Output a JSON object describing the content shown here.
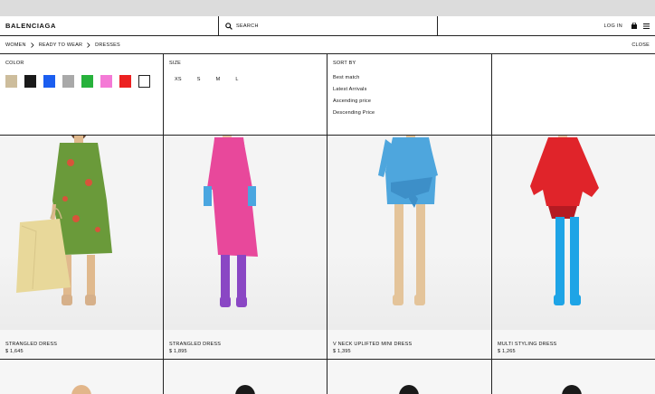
{
  "header": {
    "logo": "BALENCIAGA",
    "search_label": "SEARCH",
    "login_label": "LOG IN"
  },
  "breadcrumb": {
    "items": [
      "WOMEN",
      "READY TO WEAR",
      "DRESSES"
    ],
    "close_label": "CLOSE"
  },
  "filters": {
    "color": {
      "title": "COLOR",
      "swatches": [
        "#cdbd9c",
        "#1a1a1a",
        "#1b5ef0",
        "#a9a9a9",
        "#27b23b",
        "#f47ad6",
        "#ec2121",
        "#ffffff"
      ]
    },
    "size": {
      "title": "SIZE",
      "options": [
        "XS",
        "S",
        "M",
        "L"
      ]
    },
    "sort": {
      "title": "SORT BY",
      "options": [
        "Best match",
        "Latest Arrivals",
        "Ascending price",
        "Descending Price"
      ]
    }
  },
  "products": [
    {
      "name": "STRANGLED DRESS",
      "price": "$ 1,645",
      "colors": {
        "dress": "#6a9a3a",
        "accent": "#d8543a",
        "legs": "#e0b98d",
        "shoes": "#d6b08a",
        "bag": "#e8d89a"
      }
    },
    {
      "name": "STRANGLED DRESS",
      "price": "$ 1,895",
      "colors": {
        "dress": "#e8489b",
        "accent": "#4aa6e0",
        "legs": "#8a47c4",
        "shoes": "#8a47c4"
      }
    },
    {
      "name": "V NECK UPLIFTED MINI DRESS",
      "price": "$ 1,395",
      "colors": {
        "dress": "#4ea6dd",
        "accent": "#3d8fc8",
        "legs": "#e4c49a",
        "shoes": "#e4c49a"
      }
    },
    {
      "name": "MULTI STYLING DRESS",
      "price": "$ 1,265",
      "colors": {
        "dress": "#e0242a",
        "accent": "#b51a22",
        "legs": "#1ea4e6",
        "shoes": "#1ea4e6"
      }
    }
  ]
}
